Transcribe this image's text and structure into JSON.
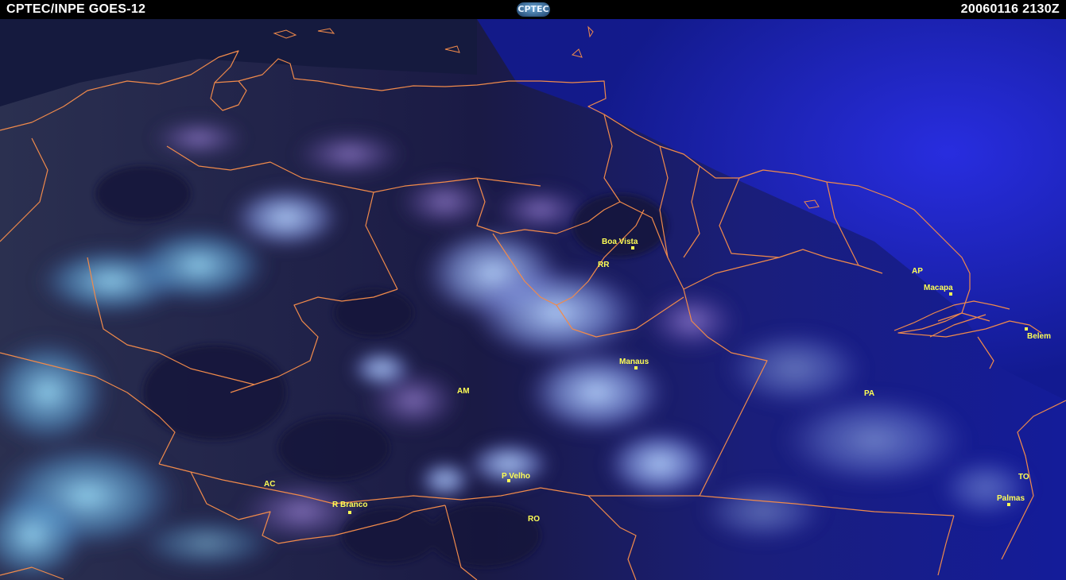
{
  "header": {
    "left_title": "CPTEC/INPE GOES-12",
    "logo_text": "CPTEC",
    "datetime": "20060116  2130Z"
  },
  "colors": {
    "header_bg": "#000000",
    "header_text": "#ffffff",
    "border_lines": "#f08a4b",
    "labels": "#ffff55",
    "ocean": "#1a1fb8",
    "dark_land": "#1a1840",
    "cloud": "#9fc6ff"
  },
  "map": {
    "cities": [
      {
        "name": "Boa Vista"
      },
      {
        "name": "Macapa"
      },
      {
        "name": "Belem"
      },
      {
        "name": "Manaus"
      },
      {
        "name": "P Velho"
      },
      {
        "name": "R Branco"
      },
      {
        "name": "Palmas"
      }
    ],
    "states": [
      {
        "name": "RR"
      },
      {
        "name": "AP"
      },
      {
        "name": "AM"
      },
      {
        "name": "PA"
      },
      {
        "name": "AC"
      },
      {
        "name": "RO"
      },
      {
        "name": "TO"
      }
    ]
  }
}
